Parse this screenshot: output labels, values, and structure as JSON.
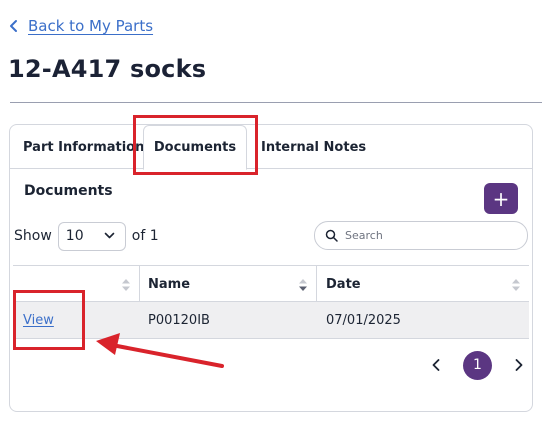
{
  "nav": {
    "back_label": "Back to My Parts"
  },
  "page": {
    "title": "12-A417 socks"
  },
  "tabs": [
    {
      "label": "Part Information",
      "active": false
    },
    {
      "label": "Documents",
      "active": true
    },
    {
      "label": "Internal Notes",
      "active": false
    }
  ],
  "documents": {
    "title": "Documents",
    "add_label": "+",
    "show_label": "Show",
    "page_size": "10",
    "of_label": "of 1",
    "search_placeholder": "Search",
    "columns": {
      "view": "",
      "name": "Name",
      "date": "Date"
    },
    "rows": [
      {
        "action": "View",
        "name": "P00120IB",
        "date": "07/01/2025"
      }
    ],
    "pagination": {
      "current_page": "1"
    }
  },
  "colors": {
    "accent": "#5b3682",
    "link": "#3b6fc9",
    "annotation": "#d9232b"
  }
}
